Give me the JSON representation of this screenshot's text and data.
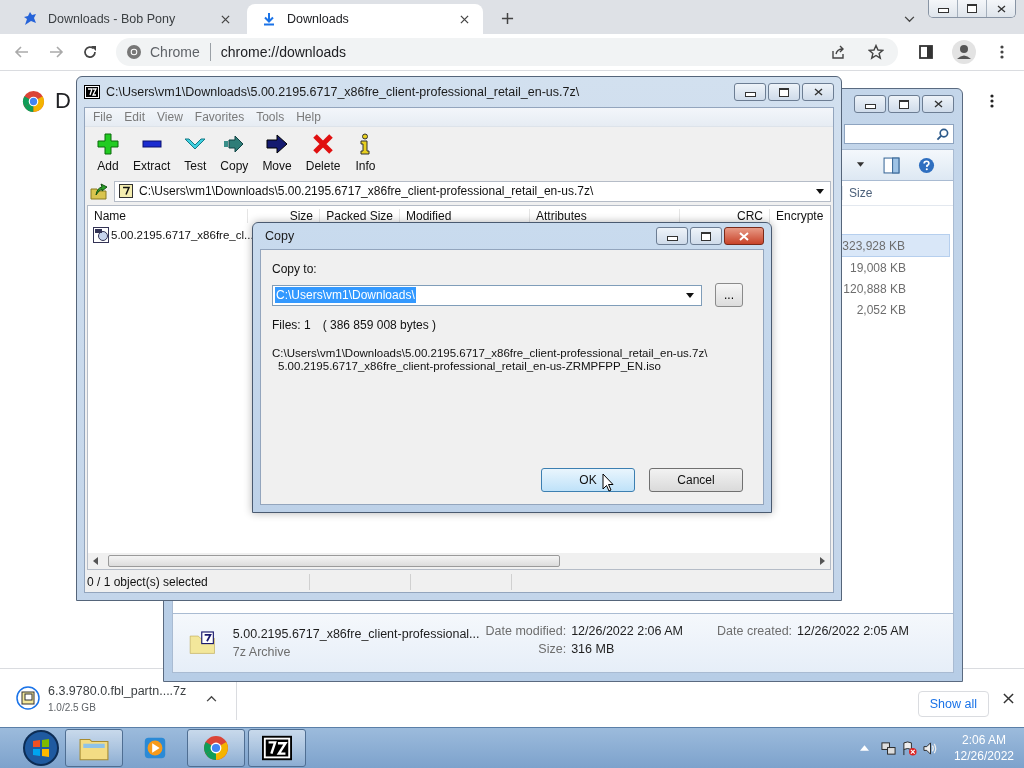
{
  "browser": {
    "tabs": [
      {
        "title": "Downloads - Bob Pony",
        "kind": "site",
        "selected": false
      },
      {
        "title": "Downloads",
        "kind": "download",
        "selected": true
      }
    ],
    "site_label": "Chrome",
    "url": "chrome://downloads",
    "page_heading": "D"
  },
  "explorer_window": {
    "size_header": "Size",
    "sizes": [
      {
        "text": "323,928 KB",
        "selected": true
      },
      {
        "text": "19,008 KB",
        "selected": false
      },
      {
        "text": "120,888 KB",
        "selected": false
      },
      {
        "text": "2,052 KB",
        "selected": false
      }
    ],
    "details": {
      "name": "5.00.2195.6717_x86fre_client-professional...",
      "type": "7z Archive",
      "modified_label": "Date modified:",
      "modified": "12/26/2022 2:06 AM",
      "created_label": "Date created:",
      "created": "12/26/2022 2:05 AM",
      "size_label": "Size:",
      "size": "316 MB"
    }
  },
  "archive_window": {
    "title": "C:\\Users\\vm1\\Downloads\\5.00.2195.6717_x86fre_client-professional_retail_en-us.7z\\",
    "menu": [
      "File",
      "Edit",
      "View",
      "Favorites",
      "Tools",
      "Help"
    ],
    "toolbar": [
      {
        "label": "Add",
        "kind": "add"
      },
      {
        "label": "Extract",
        "kind": "extract"
      },
      {
        "label": "Test",
        "kind": "test"
      },
      {
        "label": "Copy",
        "kind": "copy"
      },
      {
        "label": "Move",
        "kind": "move"
      },
      {
        "label": "Delete",
        "kind": "delete"
      },
      {
        "label": "Info",
        "kind": "info"
      }
    ],
    "path": "C:\\Users\\vm1\\Downloads\\5.00.2195.6717_x86fre_client-professional_retail_en-us.7z\\",
    "columns": [
      "Name",
      "Size",
      "Packed Size",
      "Modified",
      "Attributes",
      "CRC",
      "Encrypte"
    ],
    "rows": [
      {
        "name": "5.00.2195.6717_x86fre_cl...",
        "selected": false
      }
    ],
    "status": "0 / 1 object(s) selected"
  },
  "copy_dialog": {
    "title": "Copy",
    "label": "Copy to:",
    "value": "C:\\Users\\vm1\\Downloads\\",
    "highlighted": true,
    "files": "Files: 1",
    "bytes": "( 386 859 008 bytes )",
    "paths": [
      "C:\\Users\\vm1\\Downloads\\5.00.2195.6717_x86fre_client-professional_retail_en-us.7z\\",
      "5.00.2195.6717_x86fre_client-professional_retail_en-us-ZRMPFPP_EN.iso"
    ],
    "browse": "...",
    "buttons": [
      {
        "label": "OK",
        "focused": true
      },
      {
        "label": "Cancel",
        "focused": false
      }
    ]
  },
  "download_bar": {
    "file": "6.3.9780.0.fbl_partn....7z",
    "progress": "1.0/2.5 GB",
    "show_all": "Show all"
  },
  "taskbar": {
    "apps": [
      {
        "kind": "explorer",
        "running": true
      },
      {
        "kind": "media",
        "running": false
      },
      {
        "kind": "chrome",
        "running": true
      },
      {
        "kind": "sevenzip",
        "running": true
      }
    ],
    "time": "2:06 AM",
    "date": "12/26/2022"
  }
}
